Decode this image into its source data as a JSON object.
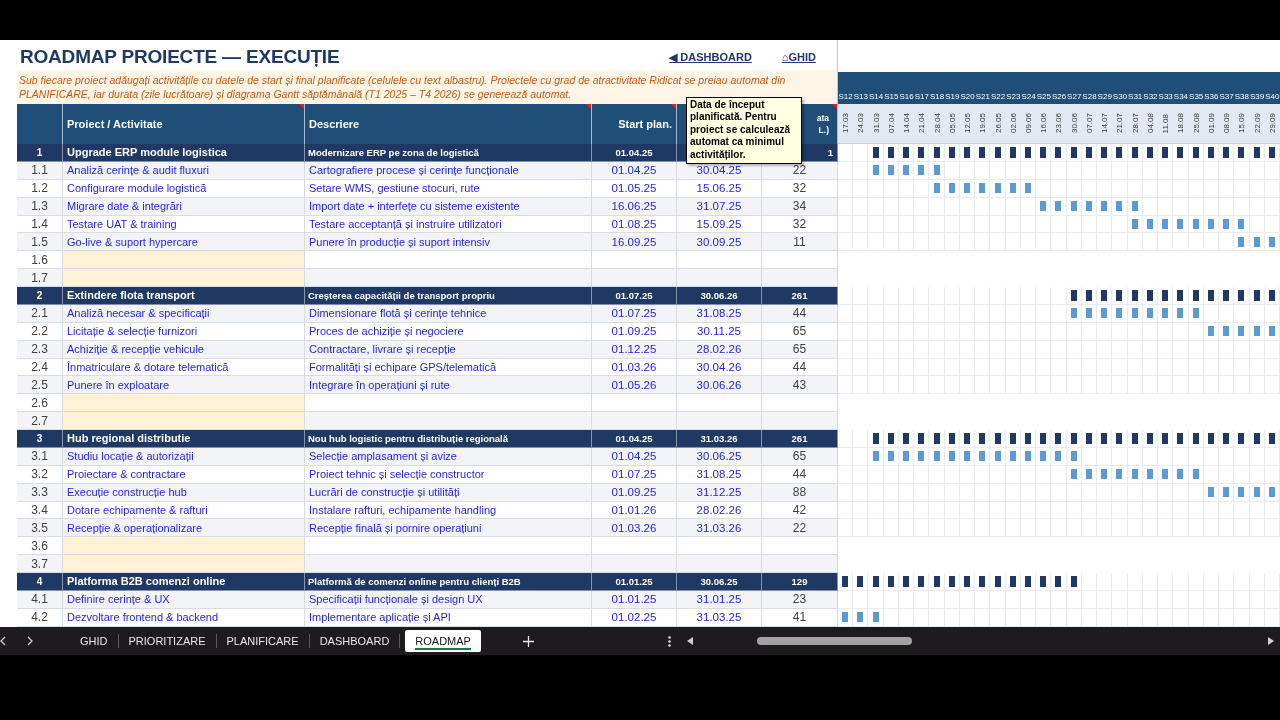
{
  "title": "ROADMAP PROIECTE — EXECUȚIE",
  "links": [
    "◀ DASHBOARD",
    "⌂GHID"
  ],
  "instructions": "Sub fiecare proiect adăugați activitățile cu datele de start și final planificate (celulele cu text albastru). Proiectele cu grad de atractivitate Ridicat se preiau automat din PLANIFICARE, iar durata (zile lucrătoare) și diagrama Gantt săptămânală (T1 2025 – T4 2026) se generează automat.",
  "table": {
    "columns": [
      {
        "label": "Proiect / Activitate",
        "comment": true
      },
      {
        "label": "Descriere",
        "comment": true
      },
      {
        "label": "Start plan.",
        "comment": true
      },
      {
        "label": "ata\nL.)",
        "comment": true
      }
    ],
    "comment_popup": "Data de început planificată. Pentru proiect se calculează automat ca minimul activităților.",
    "rows": [
      {
        "kind": "project",
        "id": "1",
        "activity": "Upgrade ERP module logistica",
        "description": "Modernizare ERP pe zona de logistică",
        "start": "01.04.25",
        "days": "1",
        "gantt": [
          false,
          false,
          true,
          true,
          true,
          true,
          true,
          true,
          true,
          true,
          true,
          true,
          true,
          true,
          true,
          true,
          true,
          true,
          true,
          true,
          true,
          true,
          true,
          true,
          true,
          true,
          true,
          true,
          true
        ]
      },
      {
        "kind": "activity",
        "id": "1.1",
        "activity": "Analiză cerințe & audit fluxuri",
        "description": "Cartografiere procese și cerințe funcționale",
        "start": "01.04.25",
        "end": "30.04.25",
        "days": "22",
        "gantt": [
          false,
          false,
          true,
          true,
          true,
          true,
          true,
          false,
          false,
          false,
          false,
          false,
          false,
          false,
          false,
          false,
          false,
          false,
          false,
          false,
          false,
          false,
          false,
          false,
          false,
          false,
          false,
          false,
          false
        ]
      },
      {
        "kind": "activity",
        "id": "1.2",
        "activity": "Configurare module logistică",
        "description": "Setare WMS, gestiune stocuri, rute",
        "start": "01.05.25",
        "end": "15.06.25",
        "days": "32",
        "gantt": [
          false,
          false,
          false,
          false,
          false,
          false,
          true,
          true,
          true,
          true,
          true,
          true,
          true,
          false,
          false,
          false,
          false,
          false,
          false,
          false,
          false,
          false,
          false,
          false,
          false,
          false,
          false,
          false,
          false
        ]
      },
      {
        "kind": "activity",
        "id": "1.3",
        "activity": "Migrare date & integrări",
        "description": "Import date + interfețe cu sisteme existente",
        "start": "16.06.25",
        "end": "31.07.25",
        "days": "34",
        "gantt": [
          false,
          false,
          false,
          false,
          false,
          false,
          false,
          false,
          false,
          false,
          false,
          false,
          false,
          true,
          true,
          true,
          true,
          true,
          true,
          true,
          false,
          false,
          false,
          false,
          false,
          false,
          false,
          false,
          false
        ]
      },
      {
        "kind": "activity",
        "id": "1.4",
        "activity": "Testare UAT & training",
        "description": "Testare acceptanță și instruire utilizatori",
        "start": "01.08.25",
        "end": "15.09.25",
        "days": "32",
        "gantt": [
          false,
          false,
          false,
          false,
          false,
          false,
          false,
          false,
          false,
          false,
          false,
          false,
          false,
          false,
          false,
          false,
          false,
          false,
          false,
          true,
          true,
          true,
          true,
          true,
          true,
          true,
          true,
          false,
          false
        ]
      },
      {
        "kind": "activity",
        "id": "1.5",
        "activity": "Go-live & suport hypercare",
        "description": "Punere în producție și suport intensiv",
        "start": "16.09.25",
        "end": "30.09.25",
        "days": "11",
        "gantt": [
          false,
          false,
          false,
          false,
          false,
          false,
          false,
          false,
          false,
          false,
          false,
          false,
          false,
          false,
          false,
          false,
          false,
          false,
          false,
          false,
          false,
          false,
          false,
          false,
          false,
          false,
          true,
          true,
          true
        ]
      },
      {
        "kind": "blank",
        "id": "1.6"
      },
      {
        "kind": "blank",
        "id": "1.7"
      },
      {
        "kind": "project",
        "id": "2",
        "activity": "Extindere flota transport",
        "description": "Creșterea capacității de transport propriu",
        "start": "01.07.25",
        "end": "30.06.26",
        "days": "261",
        "gantt": [
          false,
          false,
          false,
          false,
          false,
          false,
          false,
          false,
          false,
          false,
          false,
          false,
          false,
          false,
          false,
          true,
          true,
          true,
          true,
          true,
          true,
          true,
          true,
          true,
          true,
          true,
          true,
          true,
          true
        ]
      },
      {
        "kind": "activity",
        "id": "2.1",
        "activity": "Analiză necesar & specificații",
        "description": "Dimensionare flotă și cerințe tehnice",
        "start": "01.07.25",
        "end": "31.08.25",
        "days": "44",
        "gantt": [
          false,
          false,
          false,
          false,
          false,
          false,
          false,
          false,
          false,
          false,
          false,
          false,
          false,
          false,
          false,
          true,
          true,
          true,
          true,
          true,
          true,
          true,
          true,
          true,
          false,
          false,
          false,
          false,
          false
        ]
      },
      {
        "kind": "activity",
        "id": "2.2",
        "activity": "Licitație & selecție furnizori",
        "description": "Proces de achiziție și negociere",
        "start": "01.09.25",
        "end": "30.11.25",
        "days": "65",
        "gantt": [
          false,
          false,
          false,
          false,
          false,
          false,
          false,
          false,
          false,
          false,
          false,
          false,
          false,
          false,
          false,
          false,
          false,
          false,
          false,
          false,
          false,
          false,
          false,
          false,
          true,
          true,
          true,
          true,
          true
        ]
      },
      {
        "kind": "activity",
        "id": "2.3",
        "activity": "Achiziție & recepție vehicule",
        "description": "Contractare, livrare și recepție",
        "start": "01.12.25",
        "end": "28.02.26",
        "days": "65",
        "gantt": [
          false,
          false,
          false,
          false,
          false,
          false,
          false,
          false,
          false,
          false,
          false,
          false,
          false,
          false,
          false,
          false,
          false,
          false,
          false,
          false,
          false,
          false,
          false,
          false,
          false,
          false,
          false,
          false,
          false
        ]
      },
      {
        "kind": "activity",
        "id": "2.4",
        "activity": "Înmatriculare & dotare telematică",
        "description": "Formalități și echipare GPS/telematică",
        "start": "01.03.26",
        "end": "30.04.26",
        "days": "44",
        "gantt": [
          false,
          false,
          false,
          false,
          false,
          false,
          false,
          false,
          false,
          false,
          false,
          false,
          false,
          false,
          false,
          false,
          false,
          false,
          false,
          false,
          false,
          false,
          false,
          false,
          false,
          false,
          false,
          false,
          false
        ]
      },
      {
        "kind": "activity",
        "id": "2.5",
        "activity": "Punere în exploatare",
        "description": "Integrare în operațiuni și rute",
        "start": "01.05.26",
        "end": "30.06.26",
        "days": "43",
        "gantt": [
          false,
          false,
          false,
          false,
          false,
          false,
          false,
          false,
          false,
          false,
          false,
          false,
          false,
          false,
          false,
          false,
          false,
          false,
          false,
          false,
          false,
          false,
          false,
          false,
          false,
          false,
          false,
          false,
          false
        ]
      },
      {
        "kind": "blank",
        "id": "2.6"
      },
      {
        "kind": "blank",
        "id": "2.7"
      },
      {
        "kind": "project",
        "id": "3",
        "activity": "Hub regional distributie",
        "description": "Nou hub logistic pentru distribuție regională",
        "start": "01.04.25",
        "end": "31.03.26",
        "days": "261",
        "gantt": [
          false,
          false,
          true,
          true,
          true,
          true,
          true,
          true,
          true,
          true,
          true,
          true,
          true,
          true,
          true,
          true,
          true,
          true,
          true,
          true,
          true,
          true,
          true,
          true,
          true,
          true,
          true,
          true,
          true
        ]
      },
      {
        "kind": "activity",
        "id": "3.1",
        "activity": "Studiu locație & autorizații",
        "description": "Selecție amplasament și avize",
        "start": "01.04.25",
        "end": "30.06.25",
        "days": "65",
        "gantt": [
          false,
          false,
          true,
          true,
          true,
          true,
          true,
          true,
          true,
          true,
          true,
          true,
          true,
          true,
          true,
          true,
          false,
          false,
          false,
          false,
          false,
          false,
          false,
          false,
          false,
          false,
          false,
          false,
          false
        ]
      },
      {
        "kind": "activity",
        "id": "3.2",
        "activity": "Proiectare & contractare",
        "description": "Proiect tehnic și selecție constructor",
        "start": "01.07.25",
        "end": "31.08.25",
        "days": "44",
        "gantt": [
          false,
          false,
          false,
          false,
          false,
          false,
          false,
          false,
          false,
          false,
          false,
          false,
          false,
          false,
          false,
          true,
          true,
          true,
          true,
          true,
          true,
          true,
          true,
          true,
          false,
          false,
          false,
          false,
          false
        ]
      },
      {
        "kind": "activity",
        "id": "3.3",
        "activity": "Execuție construcție hub",
        "description": "Lucrări de construcție și utilități",
        "start": "01.09.25",
        "end": "31.12.25",
        "days": "88",
        "gantt": [
          false,
          false,
          false,
          false,
          false,
          false,
          false,
          false,
          false,
          false,
          false,
          false,
          false,
          false,
          false,
          false,
          false,
          false,
          false,
          false,
          false,
          false,
          false,
          false,
          true,
          true,
          true,
          true,
          true
        ]
      },
      {
        "kind": "activity",
        "id": "3.4",
        "activity": "Dotare echipamente & rafturi",
        "description": "Instalare rafturi, echipamente handling",
        "start": "01.01.26",
        "end": "28.02.26",
        "days": "42",
        "gantt": [
          false,
          false,
          false,
          false,
          false,
          false,
          false,
          false,
          false,
          false,
          false,
          false,
          false,
          false,
          false,
          false,
          false,
          false,
          false,
          false,
          false,
          false,
          false,
          false,
          false,
          false,
          false,
          false,
          false
        ]
      },
      {
        "kind": "activity",
        "id": "3.5",
        "activity": "Recepție & operaționalizare",
        "description": "Recepție finală și pornire operațiuni",
        "start": "01.03.26",
        "end": "31.03.26",
        "days": "22",
        "gantt": [
          false,
          false,
          false,
          false,
          false,
          false,
          false,
          false,
          false,
          false,
          false,
          false,
          false,
          false,
          false,
          false,
          false,
          false,
          false,
          false,
          false,
          false,
          false,
          false,
          false,
          false,
          false,
          false,
          false
        ]
      },
      {
        "kind": "blank",
        "id": "3.6"
      },
      {
        "kind": "blank",
        "id": "3.7"
      },
      {
        "kind": "project",
        "id": "4",
        "activity": "Platforma B2B comenzi online",
        "description": "Platformă de comenzi online pentru clienți B2B",
        "start": "01.01.25",
        "end": "30.06.25",
        "days": "129",
        "gantt": [
          true,
          true,
          true,
          true,
          true,
          true,
          true,
          true,
          true,
          true,
          true,
          true,
          true,
          true,
          true,
          true,
          false,
          false,
          false,
          false,
          false,
          false,
          false,
          false,
          false,
          false,
          false,
          false,
          false
        ]
      },
      {
        "kind": "activity",
        "id": "4.1",
        "activity": "Definire cerințe & UX",
        "description": "Specificații funcționale și design UX",
        "start": "01.01.25",
        "end": "31.01.25",
        "days": "23",
        "gantt": [
          false,
          false,
          false,
          false,
          false,
          false,
          false,
          false,
          false,
          false,
          false,
          false,
          false,
          false,
          false,
          false,
          false,
          false,
          false,
          false,
          false,
          false,
          false,
          false,
          false,
          false,
          false,
          false,
          false
        ]
      },
      {
        "kind": "activity",
        "id": "4.2",
        "activity": "Dezvoltare frontend & backend",
        "description": "Implementare aplicație și API",
        "start": "01.02.25",
        "end": "31.03.25",
        "days": "41",
        "gantt": [
          true,
          true,
          true,
          false,
          false,
          false,
          false,
          false,
          false,
          false,
          false,
          false,
          false,
          false,
          false,
          false,
          false,
          false,
          false,
          false,
          false,
          false,
          false,
          false,
          false,
          false,
          false,
          false,
          false
        ]
      }
    ]
  },
  "gantt": {
    "weeks": [
      {
        "label": "S12",
        "date": "17.03"
      },
      {
        "label": "S13",
        "date": "24.03"
      },
      {
        "label": "S14",
        "date": "31.03"
      },
      {
        "label": "S15",
        "date": "07.04"
      },
      {
        "label": "S16",
        "date": "14.04"
      },
      {
        "label": "S17",
        "date": "21.04"
      },
      {
        "label": "S18",
        "date": "28.04"
      },
      {
        "label": "S19",
        "date": "05.05"
      },
      {
        "label": "S20",
        "date": "12.05"
      },
      {
        "label": "S21",
        "date": "19.05"
      },
      {
        "label": "S22",
        "date": "26.05"
      },
      {
        "label": "S23",
        "date": "02.06"
      },
      {
        "label": "S24",
        "date": "09.06"
      },
      {
        "label": "S25",
        "date": "16.06"
      },
      {
        "label": "S26",
        "date": "23.06"
      },
      {
        "label": "S27",
        "date": "30.06"
      },
      {
        "label": "S28",
        "date": "07.07"
      },
      {
        "label": "S29",
        "date": "14.07"
      },
      {
        "label": "S30",
        "date": "21.07"
      },
      {
        "label": "S31",
        "date": "28.07"
      },
      {
        "label": "S32",
        "date": "04.08"
      },
      {
        "label": "S33",
        "date": "11.08"
      },
      {
        "label": "S34",
        "date": "18.08"
      },
      {
        "label": "S35",
        "date": "25.08"
      },
      {
        "label": "S36",
        "date": "01.09"
      },
      {
        "label": "S37",
        "date": "08.09"
      },
      {
        "label": "S38",
        "date": "15.09"
      },
      {
        "label": "S39",
        "date": "22.09"
      },
      {
        "label": "S40",
        "date": "29.09"
      }
    ]
  },
  "sheet_tabs": [
    {
      "label": "GHID",
      "selected": false
    },
    {
      "label": "PRIORITIZARE",
      "selected": false
    },
    {
      "label": "PLANIFICARE",
      "selected": false
    },
    {
      "label": "DASHBOARD",
      "selected": false
    },
    {
      "label": "ROADMAP",
      "selected": true
    }
  ]
}
